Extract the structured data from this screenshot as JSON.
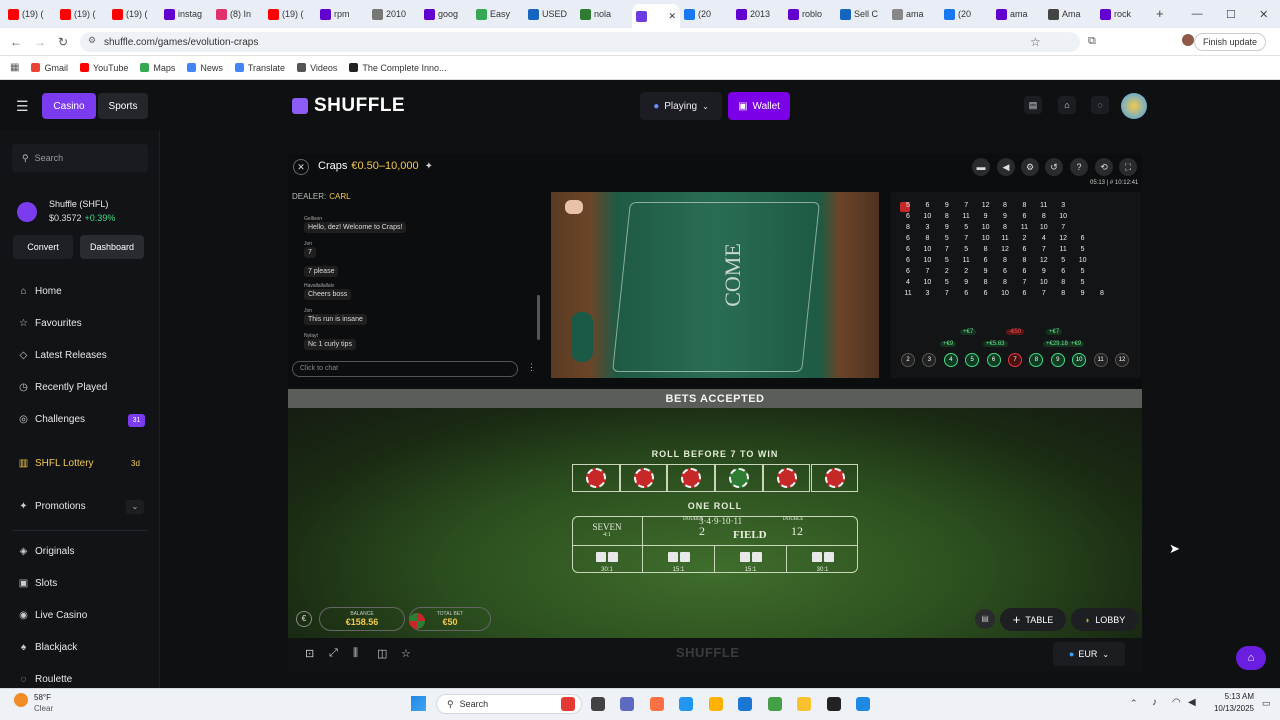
{
  "browser": {
    "tabs": [
      {
        "label": "(19) (",
        "color": "#ff0000"
      },
      {
        "label": "(19) (",
        "color": "#ff0000"
      },
      {
        "label": "(19) (",
        "color": "#ff0000"
      },
      {
        "label": "instag",
        "color": "#6001d2"
      },
      {
        "label": "(8) In",
        "color": "#e1306c"
      },
      {
        "label": "(19) (",
        "color": "#ff0000"
      },
      {
        "label": "rpm ",
        "color": "#6001d2"
      },
      {
        "label": "2010",
        "color": "#777777"
      },
      {
        "label": "goog",
        "color": "#6001d2"
      },
      {
        "label": "Easy",
        "color": "#34a853"
      },
      {
        "label": "USED",
        "color": "#1565c0"
      },
      {
        "label": "nola",
        "color": "#2e7d32"
      },
      {
        "label": "",
        "color": "#6c3ce0"
      },
      {
        "label": "(20",
        "color": "#1877f2"
      },
      {
        "label": "2013",
        "color": "#6001d2"
      },
      {
        "label": "roblo",
        "color": "#6001d2"
      },
      {
        "label": "Sell C",
        "color": "#1565c0"
      },
      {
        "label": "ama",
        "color": "#888888"
      },
      {
        "label": "(20",
        "color": "#1877f2"
      },
      {
        "label": "ama",
        "color": "#6001d2"
      },
      {
        "label": "Ama",
        "color": "#444444"
      },
      {
        "label": "rock",
        "color": "#6001d2"
      }
    ],
    "new_tab": "+",
    "url": "shuffle.com/games/evolution-craps",
    "finish_update": "Finish update",
    "bookmarks": [
      {
        "label": "Gmail",
        "color": "#ea4335"
      },
      {
        "label": "YouTube",
        "color": "#ff0000"
      },
      {
        "label": "Maps",
        "color": "#34a853"
      },
      {
        "label": "News",
        "color": "#4285f4"
      },
      {
        "label": "Translate",
        "color": "#4285f4"
      },
      {
        "label": "Videos",
        "color": "#555555"
      },
      {
        "label": "The Complete Inno...",
        "color": "#222222"
      }
    ]
  },
  "header": {
    "casino": "Casino",
    "sports": "Sports",
    "logo": "SHUFFLE",
    "playing": "Playing",
    "wallet": "Wallet"
  },
  "sidebar": {
    "search_placeholder": "Search",
    "token_name": "Shuffle (SHFL)",
    "token_price": "$0.3572",
    "token_change": "+0.39%",
    "convert": "Convert",
    "dashboard": "Dashboard",
    "items": [
      {
        "label": "Home",
        "icon": "home-icon",
        "glyph": "⌂"
      },
      {
        "label": "Favourites",
        "icon": "star-icon",
        "glyph": "☆"
      },
      {
        "label": "Latest Releases",
        "icon": "shield-icon",
        "glyph": "◇"
      },
      {
        "label": "Recently Played",
        "icon": "clock-icon",
        "glyph": "◷"
      },
      {
        "label": "Challenges",
        "icon": "target-icon",
        "glyph": "◎",
        "badge": "31"
      }
    ],
    "lottery": "SHFL Lottery",
    "lottery_badge": "3d",
    "promotions": "Promotions",
    "games": [
      {
        "label": "Originals",
        "icon": "originals-icon",
        "glyph": "◈"
      },
      {
        "label": "Slots",
        "icon": "slots-icon",
        "glyph": "▣"
      },
      {
        "label": "Live Casino",
        "icon": "live-icon",
        "glyph": "◉"
      },
      {
        "label": "Blackjack",
        "icon": "cards-icon",
        "glyph": "♠"
      },
      {
        "label": "Roulette",
        "icon": "roulette-icon",
        "glyph": "◌"
      }
    ]
  },
  "game": {
    "title": "Craps",
    "limits": "€0.50–10,000",
    "dealer_label": "DEALER:",
    "dealer_name": "CARL",
    "clock": "05:13 | # 10:12:41",
    "chat": [
      {
        "name": "Gellison",
        "text": "Hello, dez! Welcome to Craps!"
      },
      {
        "name": "Jon",
        "text": "7"
      },
      {
        "name": "",
        "text": "7 please"
      },
      {
        "name": "Havallallallalv",
        "text": "Cheers boss"
      },
      {
        "name": "Jon",
        "text": "This run is insane"
      },
      {
        "name": "Nylayt",
        "text": "Nc 1 curly tips"
      }
    ],
    "chat_placeholder": "Click to chat",
    "roads": [
      [
        "5",
        "6",
        "9",
        "7",
        "12",
        "8",
        "8",
        "11",
        "3"
      ],
      [
        "6",
        "10",
        "8",
        "11",
        "9",
        "9",
        "6",
        "8",
        "10"
      ],
      [
        "8",
        "3",
        "9",
        "5",
        "10",
        "8",
        "11",
        "10",
        "7"
      ],
      [
        "6",
        "8",
        "5",
        "7",
        "10",
        "11",
        "2",
        "4",
        "12",
        "6"
      ],
      [
        "6",
        "10",
        "7",
        "5",
        "8",
        "12",
        "6",
        "7",
        "11",
        "5"
      ],
      [
        "6",
        "10",
        "5",
        "11",
        "6",
        "8",
        "8",
        "12",
        "5",
        "10"
      ],
      [
        "6",
        "7",
        "2",
        "2",
        "9",
        "6",
        "6",
        "9",
        "6",
        "5"
      ],
      [
        "4",
        "10",
        "5",
        "9",
        "8",
        "8",
        "7",
        "10",
        "8",
        "5"
      ],
      [
        "11",
        "3",
        "7",
        "6",
        "6",
        "10",
        "6",
        "7",
        "8",
        "9",
        "8"
      ]
    ],
    "tracker_numbers": [
      "2",
      "3",
      "4",
      "5",
      "6",
      "7",
      "8",
      "9",
      "10",
      "11",
      "12"
    ],
    "tracker_wins": [
      "+€9",
      "+€5.83",
      "",
      "+€29.18",
      "+€9"
    ],
    "tracker_top": [
      "+€7",
      "-€50",
      "+€7"
    ],
    "status": "BETS ACCEPTED",
    "roll_before": "ROLL BEFORE 7 TO WIN",
    "one_roll": "ONE ROLL",
    "seven": "SEVEN",
    "seven_odds": "4:1",
    "field": "FIELD",
    "field_numbers": "3·4·9·10·11",
    "field_two": "2",
    "field_twelve": "12",
    "field_double": "DOUBLE",
    "prop_odds": [
      "30:1",
      "15:1",
      "15:1",
      "30:1"
    ],
    "balance_label": "BALANCE",
    "balance": "€158.56",
    "total_bet_label": "TOTAL BET",
    "total_bet": "€50",
    "table_btn": "TABLE",
    "lobby_btn": "LOBBY",
    "footer_logo": "SHUFFLE",
    "currency": "EUR"
  },
  "taskbar": {
    "weather_temp": "58°F",
    "weather_desc": "Clear",
    "search": "Search",
    "time": "5:13 AM",
    "date": "10/13/2025"
  }
}
